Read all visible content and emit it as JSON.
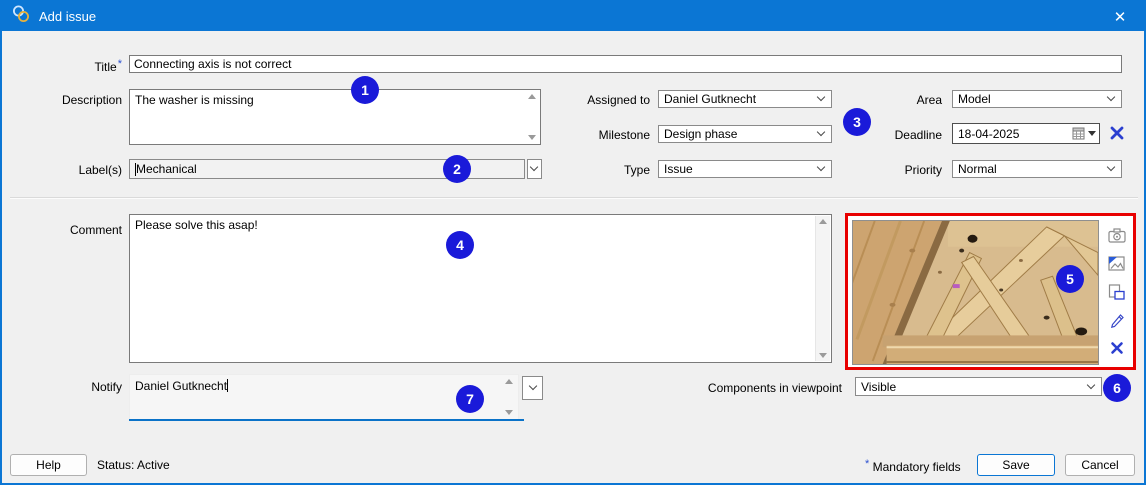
{
  "window": {
    "title": "Add issue",
    "close_icon": "✕"
  },
  "fields": {
    "title": {
      "label": "Title",
      "required_mark": "*",
      "value": "Connecting axis is not correct"
    },
    "description": {
      "label": "Description",
      "value": "The washer is missing"
    },
    "labels": {
      "label": "Label(s)",
      "value": "Mechanical"
    },
    "assigned_to": {
      "label": "Assigned to",
      "value": "Daniel Gutknecht"
    },
    "milestone": {
      "label": "Milestone",
      "value": "Design phase"
    },
    "type": {
      "label": "Type",
      "value": "Issue"
    },
    "area": {
      "label": "Area",
      "value": "Model"
    },
    "deadline": {
      "label": "Deadline",
      "value": "18-04-2025"
    },
    "priority": {
      "label": "Priority",
      "value": "Normal"
    },
    "comment": {
      "label": "Comment",
      "value": "Please solve this asap!"
    },
    "notify": {
      "label": "Notify",
      "value": "Daniel Gutknecht"
    },
    "components_in_viewpoint": {
      "label": "Components in viewpoint",
      "value": "Visible"
    }
  },
  "viewpoint_tools": {
    "icons": [
      "camera-icon",
      "image-icon",
      "copy-icon",
      "edit-icon",
      "delete-icon"
    ]
  },
  "annotations": {
    "badges": [
      "1",
      "2",
      "3",
      "4",
      "5",
      "6",
      "7"
    ]
  },
  "footer": {
    "help_label": "Help",
    "status_text": "Status: Active",
    "mandatory_mark": "*",
    "mandatory_label": "Mandatory fields",
    "save_label": "Save",
    "cancel_label": "Cancel"
  },
  "colors": {
    "titlebar": "#0b76d4",
    "badge": "#1a1ad9",
    "highlight_border": "#e80000",
    "accent_blue": "#2b3fd0",
    "notify_underline": "#0a72c8"
  }
}
